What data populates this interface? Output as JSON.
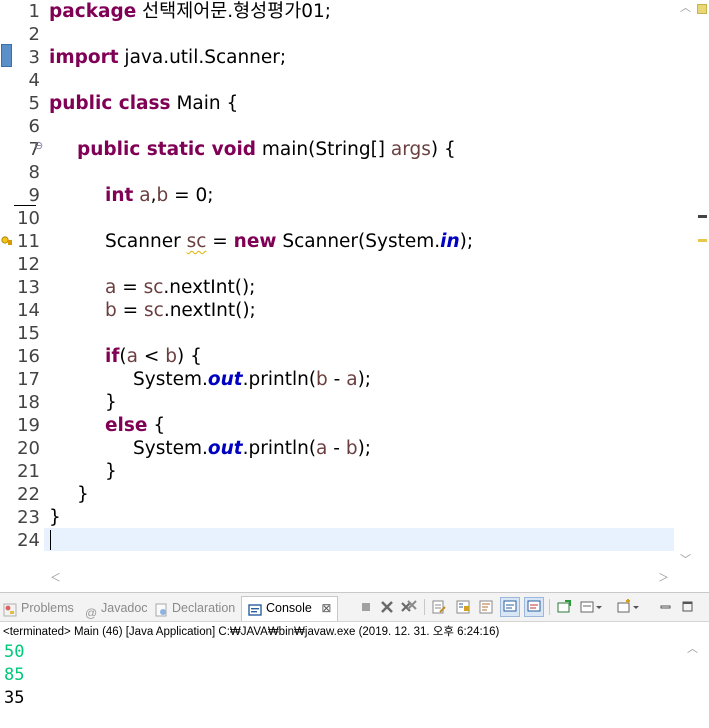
{
  "editor": {
    "line_numbers": [
      "1",
      "2",
      "3",
      "4",
      "5",
      "6",
      "7",
      "8",
      "9",
      "10",
      "11",
      "12",
      "13",
      "14",
      "15",
      "16",
      "17",
      "18",
      "19",
      "20",
      "21",
      "22",
      "23",
      "24"
    ],
    "code": {
      "l1_kw": "package",
      "l1_rest": " 선택제어문.형성평가01;",
      "l3_kw": "import",
      "l3_rest": " java.util.Scanner;",
      "l5_kw": "public class",
      "l5_rest": " Main {",
      "l7_kw": "public static void",
      "l7_rest": " main(String[] ",
      "l7_var": "args",
      "l7_end": ") {",
      "l9_kw": "int",
      "l9_a": " a",
      "l9_comma": ",",
      "l9_b": "b",
      "l9_end": " = 0;",
      "l11_start": "Scanner ",
      "l11_sc": "sc",
      "l11_eq": " = ",
      "l11_new": "new",
      "l11_mid": " Scanner(System.",
      "l11_in": "in",
      "l11_end": ");",
      "l13_a": "a",
      "l13_mid": " = ",
      "l13_sc": "sc",
      "l13_end": ".nextInt();",
      "l14_b": "b",
      "l14_mid": " = ",
      "l14_sc": "sc",
      "l14_end": ".nextInt();",
      "l16_if": "if",
      "l16_p1": "(",
      "l16_a": "a",
      "l16_lt": " < ",
      "l16_b": "b",
      "l16_end": ") {",
      "l17_start": "System.",
      "l17_out": "out",
      "l17_mid": ".println(",
      "l17_b": "b",
      "l17_minus": " - ",
      "l17_a": "a",
      "l17_end": ");",
      "l18": "}",
      "l19_else": "else",
      "l19_end": " {",
      "l20_start": "System.",
      "l20_out": "out",
      "l20_mid": ".println(",
      "l20_a": "a",
      "l20_minus": " - ",
      "l20_b": "b",
      "l20_end": ");",
      "l21": "}",
      "l22": "}",
      "l23": "}"
    },
    "fold_marker": "⊖"
  },
  "console": {
    "tabs": {
      "problems": "Problems",
      "javadoc": "Javadoc",
      "declaration": "Declaration",
      "console": "Console",
      "console_close": "⊠"
    },
    "status": "<terminated> Main (46) [Java Application] C:₩JAVA₩bin₩javaw.exe (2019. 12. 31. 오후 6:24:16)",
    "output": [
      {
        "text": "50",
        "color": "#00c87a"
      },
      {
        "text": "85",
        "color": "#00c87a"
      },
      {
        "text": "35",
        "color": "#000000"
      }
    ]
  },
  "colors": {
    "keyword": "#7f0055",
    "variable": "#6a3e3e",
    "static_field": "#0000c0",
    "current_line": "#e8f2fe",
    "input_text": "#00c87a"
  }
}
